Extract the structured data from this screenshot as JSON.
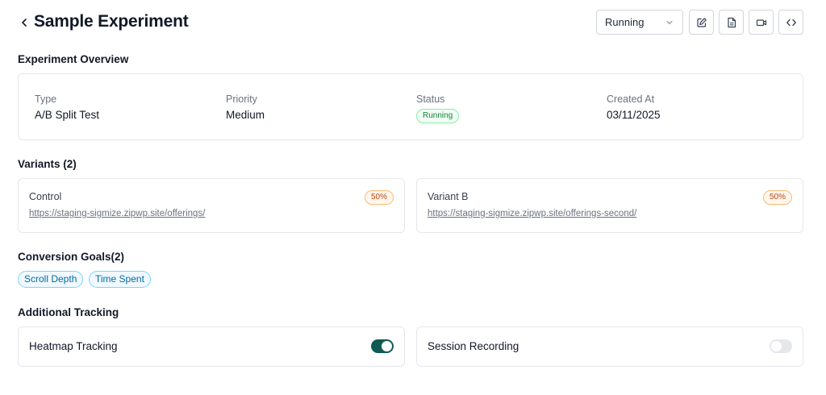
{
  "header": {
    "title": "Sample Experiment",
    "status_value": "Running"
  },
  "icons": {
    "back": "chevron-left-icon",
    "dropdown": "chevron-down-icon",
    "edit": "edit-icon",
    "document": "document-icon",
    "video": "video-icon",
    "code": "code-icon"
  },
  "overview": {
    "heading": "Experiment Overview",
    "type_label": "Type",
    "type_value": "A/B Split Test",
    "priority_label": "Priority",
    "priority_value": "Medium",
    "status_label": "Status",
    "status_value": "Running",
    "created_label": "Created At",
    "created_value": "03/11/2025"
  },
  "variants": {
    "heading": "Variants (2)",
    "items": [
      {
        "name": "Control",
        "url": "https://staging-sigmize.zipwp.site/offerings/",
        "weight": "50%"
      },
      {
        "name": "Variant B",
        "url": "https://staging-sigmize.zipwp.site/offerings-second/",
        "weight": "50%"
      }
    ]
  },
  "goals": {
    "heading": "Conversion Goals(2)",
    "items": [
      "Scroll Depth",
      "Time Spent"
    ]
  },
  "tracking": {
    "heading": "Additional Tracking",
    "heatmap_label": "Heatmap Tracking",
    "heatmap_enabled": true,
    "session_label": "Session Recording",
    "session_enabled": false
  },
  "colors": {
    "toggle_on": "#0f5a52",
    "status_green": "#15803d",
    "weight_orange": "#c2410c",
    "goal_blue": "#0369a1"
  }
}
